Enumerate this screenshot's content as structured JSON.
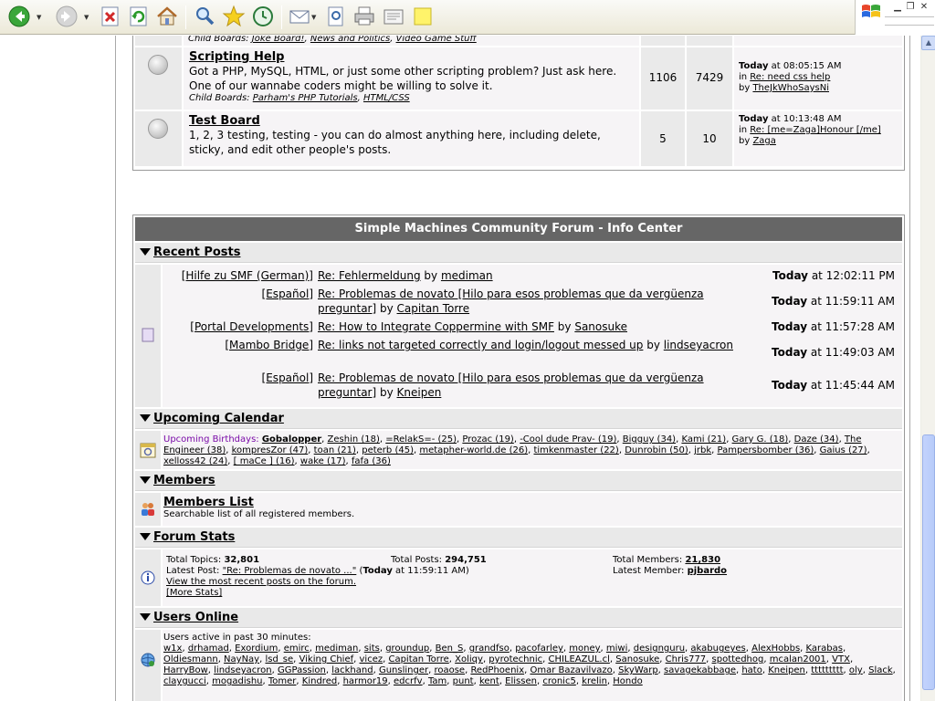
{
  "browser": {
    "toolbar_icons": [
      "back-icon",
      "forward-icon",
      "stop-icon",
      "refresh-icon",
      "home-icon",
      "search-icon",
      "favorites-icon",
      "history-icon",
      "mail-icon",
      "print-preview-icon",
      "print-icon",
      "edit-icon",
      "note-icon"
    ]
  },
  "boards": [
    {
      "child_label": "Child Boards:",
      "children": [
        "Joke Board!",
        "News and Politics",
        "Video Game Stuff"
      ]
    },
    {
      "title": "Scripting Help",
      "description": "Got a PHP, MySQL, HTML, or just some other scripting problem? Just ask here. One of our wannabe coders might be willing to solve it.",
      "child_label": "Child Boards:",
      "children": [
        "Parham's PHP Tutorials",
        "HTML/CSS"
      ],
      "topics": "1106",
      "posts": "7429",
      "last_day": "Today",
      "last_time": " at 08:05:15 AM",
      "last_in": "in ",
      "last_topic": "Re: need css help",
      "last_by": "by ",
      "last_user": "TheJkWhoSaysNi"
    },
    {
      "title": "Test Board",
      "description": "1, 2, 3 testing, testing - you can do almost anything here, including delete, sticky, and edit other people's posts.",
      "topics": "5",
      "posts": "10",
      "last_day": "Today",
      "last_time": " at 10:13:48 AM",
      "last_in": "in ",
      "last_topic": "Re: [me=Zaga]Honour [/me]",
      "last_by": "by ",
      "last_user": "Zaga"
    }
  ],
  "info_center": {
    "title": "Simple Machines Community Forum - Info Center",
    "recent_posts": {
      "heading": "Recent Posts",
      "items": [
        {
          "board": "[Hilfe zu SMF (German)]",
          "topic": "Re: Fehlermeldung",
          "by": " by ",
          "user": "mediman",
          "day": "Today",
          "time": " at 12:02:11 PM"
        },
        {
          "board": "[Español]",
          "topic": "Re: Problemas de novato [Hilo para esos problemas que da vergüenza preguntar]",
          "by": " by ",
          "user": "Capitan Torre",
          "day": "Today",
          "time": " at 11:59:11 AM"
        },
        {
          "board": "[Portal Developments]",
          "topic": "Re: How to Integrate Coppermine with SMF",
          "by": " by ",
          "user": "Sanosuke",
          "day": "Today",
          "time": " at 11:57:28 AM"
        },
        {
          "board": "[Mambo Bridge]",
          "topic": "Re: links not targeted correctly and login/logout messed up",
          "by": " by ",
          "user": "lindseyacron",
          "day": "Today",
          "time": " at 11:49:03 AM"
        },
        {
          "board": "[Español]",
          "topic": "Re: Problemas de novato [Hilo para esos problemas que da vergüenza preguntar]",
          "by": " by ",
          "user": "Kneipen",
          "day": "Today",
          "time": " at 11:45:44 AM"
        }
      ]
    },
    "calendar": {
      "heading": "Upcoming Calendar",
      "label": "Upcoming Birthdays:",
      "birthdays": [
        "Gobalopper",
        "Zeshin (18)",
        "=RelakS=- (25)",
        "Prozac (19)",
        "-Cool dude Prav- (19)",
        "Bigguy (34)",
        "Kami (21)",
        "Gary G. (18)",
        "Daze (34)",
        "The Engineer (38)",
        "kompresZor (47)",
        "toan (21)",
        "peterb (45)",
        "metapher-world.de (26)",
        "timkenmaster (22)",
        "Dunrobin (50)",
        "jrbk",
        "Pampersbomber (36)",
        "Gaius (27)",
        "xelloss42 (24)",
        "[ maCe ] (16)",
        "wake (17)",
        "fafa (36)"
      ]
    },
    "members": {
      "heading": "Members",
      "link": "Members List",
      "desc": "Searchable list of all registered members."
    },
    "stats": {
      "heading": "Forum Stats",
      "total_topics_label": "Total Topics: ",
      "total_topics": "32,801",
      "total_posts_label": "Total Posts: ",
      "total_posts": "294,751",
      "total_members_label": "Total Members: ",
      "total_members": "21,830",
      "latest_post_label": "Latest Post: ",
      "latest_post": "\"Re: Problemas de novato ...\"",
      "latest_post_time_open": " (",
      "latest_post_day": "Today",
      "latest_post_time": " at 11:59:11 AM)",
      "latest_member_label": "Latest Member: ",
      "latest_member": "pjbardo",
      "recent_link": "View the most recent posts on the forum.",
      "more_stats": "[More Stats]"
    },
    "users_online": {
      "heading": "Users Online",
      "intro": "Users active in past 30 minutes:",
      "users": [
        {
          "n": "w1x"
        },
        {
          "n": "drhamad",
          "c": "blue"
        },
        {
          "n": "Exordium"
        },
        {
          "n": "emirc"
        },
        {
          "n": "mediman",
          "c": "green"
        },
        {
          "n": "sits"
        },
        {
          "n": "groundup"
        },
        {
          "n": "Ben_S",
          "c": "green"
        },
        {
          "n": "grandfso"
        },
        {
          "n": "pacofarley"
        },
        {
          "n": "money"
        },
        {
          "n": "miwi"
        },
        {
          "n": "designguru"
        },
        {
          "n": "akabugeyes",
          "c": "orange"
        },
        {
          "n": "AlexHobbs"
        },
        {
          "n": "Karabas"
        },
        {
          "n": "Oldiesmann",
          "c": "green"
        },
        {
          "n": "NayNay",
          "c": "blue"
        },
        {
          "n": "lsd_se"
        },
        {
          "n": "Viking Chief"
        },
        {
          "n": "vicez"
        },
        {
          "n": "Capitan Torre"
        },
        {
          "n": "Xoliqy"
        },
        {
          "n": "pyrotechnic",
          "c": "blue"
        },
        {
          "n": "CHILEAZUL.cl"
        },
        {
          "n": "Sanosuke"
        },
        {
          "n": "Chris777"
        },
        {
          "n": "spottedhog"
        },
        {
          "n": "mcalan2001",
          "c": "blue"
        },
        {
          "n": "VTX"
        },
        {
          "n": "HarryBow"
        },
        {
          "n": "lindseyacron"
        },
        {
          "n": "GGPassion"
        },
        {
          "n": "lackhand"
        },
        {
          "n": "Gunslinger"
        },
        {
          "n": "roaose"
        },
        {
          "n": "RedPhoenix"
        },
        {
          "n": "Omar Bazavilvazo",
          "c": "green"
        },
        {
          "n": "SkyWarp"
        },
        {
          "n": "savagekabbage"
        },
        {
          "n": "hato"
        },
        {
          "n": "Kneipen"
        },
        {
          "n": "ttttttttt"
        },
        {
          "n": "oly"
        },
        {
          "n": "Slack",
          "c": "blue"
        },
        {
          "n": "claygucci"
        },
        {
          "n": "mogadishu"
        },
        {
          "n": "Tomer",
          "c": "green"
        },
        {
          "n": "Kindred"
        },
        {
          "n": "harmor19"
        },
        {
          "n": "edcrfv"
        },
        {
          "n": "Tam"
        },
        {
          "n": "punt"
        },
        {
          "n": "kent"
        },
        {
          "n": "Elissen",
          "c": "blue"
        },
        {
          "n": "cronic5"
        },
        {
          "n": "krelin"
        },
        {
          "n": "Hondo"
        }
      ]
    }
  }
}
